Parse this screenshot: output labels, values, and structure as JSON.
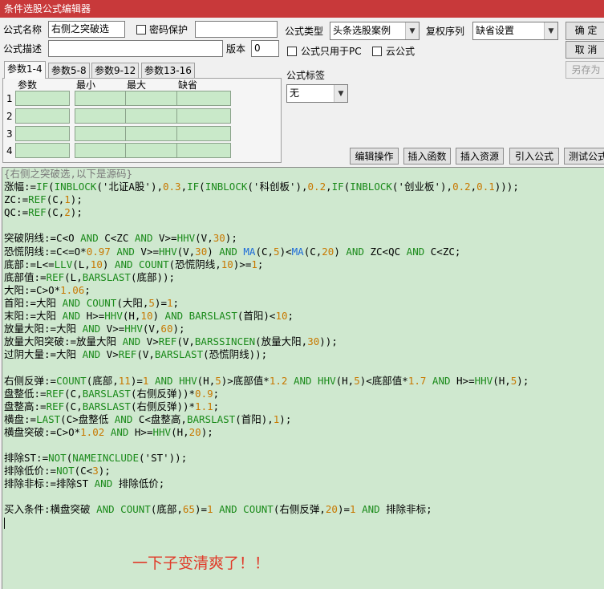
{
  "window": {
    "title": "条件选股公式编辑器"
  },
  "form": {
    "name_label": "公式名称",
    "name_value": "右侧之突破选",
    "password_label": "密码保护",
    "desc_label": "公式描述",
    "version_label": "版本",
    "version_value": "0",
    "type_label": "公式类型",
    "type_value": "头条选股案例",
    "restore_label": "复权序列",
    "restore_value": "缺省设置",
    "pc_only_label": "公式只用于PC",
    "cloud_label": "云公式",
    "tag_label": "公式标签",
    "tag_value": "无"
  },
  "buttons": {
    "ok": "确 定",
    "cancel": "取 消",
    "save_as": "另存为",
    "edit_ops": "编辑操作",
    "insert_func": "插入函数",
    "insert_res": "插入资源",
    "import": "引入公式",
    "test": "测试公式"
  },
  "tabs": [
    "参数1-4",
    "参数5-8",
    "参数9-12",
    "参数13-16"
  ],
  "params": {
    "headers": [
      "参数",
      "最小",
      "最大",
      "缺省"
    ],
    "rows": [
      "1",
      "2",
      "3",
      "4"
    ]
  },
  "code_lines": [
    [
      [
        "{右侧之突破选,以下是源码}",
        "cmt"
      ]
    ],
    [
      [
        "涨幅:=",
        ""
      ],
      [
        "IF",
        "kw"
      ],
      [
        "(",
        ""
      ],
      [
        "INBLOCK",
        "kw"
      ],
      [
        "('北证A股'),",
        ""
      ],
      [
        "0.3",
        "num"
      ],
      [
        ",",
        ""
      ],
      [
        "IF",
        "kw"
      ],
      [
        "(",
        ""
      ],
      [
        "INBLOCK",
        "kw"
      ],
      [
        "('科创板'),",
        ""
      ],
      [
        "0.2",
        "num"
      ],
      [
        ",",
        ""
      ],
      [
        "IF",
        "kw"
      ],
      [
        "(",
        ""
      ],
      [
        "INBLOCK",
        "kw"
      ],
      [
        "('创业板'),",
        ""
      ],
      [
        "0.2",
        "num"
      ],
      [
        ",",
        ""
      ],
      [
        "0.1",
        "num"
      ],
      [
        ")));",
        ""
      ]
    ],
    [
      [
        "ZC:=",
        ""
      ],
      [
        "REF",
        "kw"
      ],
      [
        "(C,",
        ""
      ],
      [
        "1",
        "num"
      ],
      [
        ");",
        ""
      ]
    ],
    [
      [
        "QC:=",
        ""
      ],
      [
        "REF",
        "kw"
      ],
      [
        "(C,",
        ""
      ],
      [
        "2",
        "num"
      ],
      [
        ");",
        ""
      ]
    ],
    [],
    [
      [
        "突破阴线:=C<O ",
        ""
      ],
      [
        "AND",
        "kw"
      ],
      [
        " C<ZC ",
        ""
      ],
      [
        "AND",
        "kw"
      ],
      [
        " V>=",
        ""
      ],
      [
        "HHV",
        "kw"
      ],
      [
        "(V,",
        ""
      ],
      [
        "30",
        "num"
      ],
      [
        ");",
        ""
      ]
    ],
    [
      [
        "恐慌阴线:=C<=O*",
        ""
      ],
      [
        "0.97",
        "num"
      ],
      [
        " ",
        ""
      ],
      [
        "AND",
        "kw"
      ],
      [
        " V>=",
        ""
      ],
      [
        "HHV",
        "kw"
      ],
      [
        "(V,",
        ""
      ],
      [
        "30",
        "num"
      ],
      [
        ") ",
        ""
      ],
      [
        "AND",
        "kw"
      ],
      [
        " ",
        ""
      ],
      [
        "MA",
        "fn2"
      ],
      [
        "(C,",
        ""
      ],
      [
        "5",
        "num"
      ],
      [
        ")<",
        ""
      ],
      [
        "MA",
        "fn2"
      ],
      [
        "(C,",
        ""
      ],
      [
        "20",
        "num"
      ],
      [
        ") ",
        ""
      ],
      [
        "AND",
        "kw"
      ],
      [
        " ZC<QC ",
        ""
      ],
      [
        "AND",
        "kw"
      ],
      [
        " C<ZC;",
        ""
      ]
    ],
    [
      [
        "底部:=L<=",
        ""
      ],
      [
        "LLV",
        "kw"
      ],
      [
        "(L,",
        ""
      ],
      [
        "10",
        "num"
      ],
      [
        ") ",
        ""
      ],
      [
        "AND",
        "kw"
      ],
      [
        " ",
        ""
      ],
      [
        "COUNT",
        "kw"
      ],
      [
        "(恐慌阴线,",
        ""
      ],
      [
        "10",
        "num"
      ],
      [
        ")>=",
        ""
      ],
      [
        "1",
        "num"
      ],
      [
        ";",
        ""
      ]
    ],
    [
      [
        "底部值:=",
        ""
      ],
      [
        "REF",
        "kw"
      ],
      [
        "(L,",
        ""
      ],
      [
        "BARSLAST",
        "kw"
      ],
      [
        "(底部));",
        ""
      ]
    ],
    [
      [
        "大阳:=C>O*",
        ""
      ],
      [
        "1.06",
        "num"
      ],
      [
        ";",
        ""
      ]
    ],
    [
      [
        "首阳:=大阳 ",
        ""
      ],
      [
        "AND",
        "kw"
      ],
      [
        " ",
        ""
      ],
      [
        "COUNT",
        "kw"
      ],
      [
        "(大阳,",
        ""
      ],
      [
        "5",
        "num"
      ],
      [
        ")=",
        ""
      ],
      [
        "1",
        "num"
      ],
      [
        ";",
        ""
      ]
    ],
    [
      [
        "末阳:=大阳 ",
        ""
      ],
      [
        "AND",
        "kw"
      ],
      [
        " H>=",
        ""
      ],
      [
        "HHV",
        "kw"
      ],
      [
        "(H,",
        ""
      ],
      [
        "10",
        "num"
      ],
      [
        ") ",
        ""
      ],
      [
        "AND",
        "kw"
      ],
      [
        " ",
        ""
      ],
      [
        "BARSLAST",
        "kw"
      ],
      [
        "(首阳)<",
        ""
      ],
      [
        "10",
        "num"
      ],
      [
        ";",
        ""
      ]
    ],
    [
      [
        "放量大阳:=大阳 ",
        ""
      ],
      [
        "AND",
        "kw"
      ],
      [
        " V>=",
        ""
      ],
      [
        "HHV",
        "kw"
      ],
      [
        "(V,",
        ""
      ],
      [
        "60",
        "num"
      ],
      [
        ");",
        ""
      ]
    ],
    [
      [
        "放量大阳突破:=放量大阳 ",
        ""
      ],
      [
        "AND",
        "kw"
      ],
      [
        " V>",
        ""
      ],
      [
        "REF",
        "kw"
      ],
      [
        "(V,",
        ""
      ],
      [
        "BARSSINCEN",
        "kw"
      ],
      [
        "(放量大阳,",
        ""
      ],
      [
        "30",
        "num"
      ],
      [
        "));",
        ""
      ]
    ],
    [
      [
        "过阴大量:=大阳 ",
        ""
      ],
      [
        "AND",
        "kw"
      ],
      [
        " V>",
        ""
      ],
      [
        "REF",
        "kw"
      ],
      [
        "(V,",
        ""
      ],
      [
        "BARSLAST",
        "kw"
      ],
      [
        "(恐慌阴线));",
        ""
      ]
    ],
    [],
    [
      [
        "右侧反弹:=",
        ""
      ],
      [
        "COUNT",
        "kw"
      ],
      [
        "(底部,",
        ""
      ],
      [
        "11",
        "num"
      ],
      [
        ")=",
        ""
      ],
      [
        "1",
        "num"
      ],
      [
        " ",
        ""
      ],
      [
        "AND",
        "kw"
      ],
      [
        " ",
        ""
      ],
      [
        "HHV",
        "kw"
      ],
      [
        "(H,",
        ""
      ],
      [
        "5",
        "num"
      ],
      [
        ")>底部值*",
        ""
      ],
      [
        "1.2",
        "num"
      ],
      [
        " ",
        ""
      ],
      [
        "AND",
        "kw"
      ],
      [
        " ",
        ""
      ],
      [
        "HHV",
        "kw"
      ],
      [
        "(H,",
        ""
      ],
      [
        "5",
        "num"
      ],
      [
        ")<底部值*",
        ""
      ],
      [
        "1.7",
        "num"
      ],
      [
        " ",
        ""
      ],
      [
        "AND",
        "kw"
      ],
      [
        " H>=",
        ""
      ],
      [
        "HHV",
        "kw"
      ],
      [
        "(H,",
        ""
      ],
      [
        "5",
        "num"
      ],
      [
        ");",
        ""
      ]
    ],
    [
      [
        "盘整低:=",
        ""
      ],
      [
        "REF",
        "kw"
      ],
      [
        "(C,",
        ""
      ],
      [
        "BARSLAST",
        "kw"
      ],
      [
        "(右侧反弹))*",
        ""
      ],
      [
        "0.9",
        "num"
      ],
      [
        ";",
        ""
      ]
    ],
    [
      [
        "盘整高:=",
        ""
      ],
      [
        "REF",
        "kw"
      ],
      [
        "(C,",
        ""
      ],
      [
        "BARSLAST",
        "kw"
      ],
      [
        "(右侧反弹))*",
        ""
      ],
      [
        "1.1",
        "num"
      ],
      [
        ";",
        ""
      ]
    ],
    [
      [
        "横盘:=",
        ""
      ],
      [
        "LAST",
        "kw"
      ],
      [
        "(C>盘整低 ",
        ""
      ],
      [
        "AND",
        "kw"
      ],
      [
        " C<盘整高,",
        ""
      ],
      [
        "BARSLAST",
        "kw"
      ],
      [
        "(首阳),",
        ""
      ],
      [
        "1",
        "num"
      ],
      [
        ");",
        ""
      ]
    ],
    [
      [
        "横盘突破:=C>O*",
        ""
      ],
      [
        "1.02",
        "num"
      ],
      [
        " ",
        ""
      ],
      [
        "AND",
        "kw"
      ],
      [
        " H>=",
        ""
      ],
      [
        "HHV",
        "kw"
      ],
      [
        "(H,",
        ""
      ],
      [
        "20",
        "num"
      ],
      [
        ");",
        ""
      ]
    ],
    [],
    [
      [
        "排除ST:=",
        ""
      ],
      [
        "NOT",
        "kw"
      ],
      [
        "(",
        ""
      ],
      [
        "NAMEINCLUDE",
        "kw"
      ],
      [
        "('ST'));",
        ""
      ]
    ],
    [
      [
        "排除低价:=",
        ""
      ],
      [
        "NOT",
        "kw"
      ],
      [
        "(C<",
        ""
      ],
      [
        "3",
        "num"
      ],
      [
        ");",
        ""
      ]
    ],
    [
      [
        "排除非标:=排除ST ",
        ""
      ],
      [
        "AND",
        "kw"
      ],
      [
        " 排除低价;",
        ""
      ]
    ],
    [],
    [
      [
        "买入条件:横盘突破 ",
        ""
      ],
      [
        "AND",
        "kw"
      ],
      [
        " ",
        ""
      ],
      [
        "COUNT",
        "kw"
      ],
      [
        "(底部,",
        ""
      ],
      [
        "65",
        "num"
      ],
      [
        ")=",
        ""
      ],
      [
        "1",
        "num"
      ],
      [
        " ",
        ""
      ],
      [
        "AND",
        "kw"
      ],
      [
        " ",
        ""
      ],
      [
        "COUNT",
        "kw"
      ],
      [
        "(右侧反弹,",
        ""
      ],
      [
        "20",
        "num"
      ],
      [
        ")=",
        ""
      ],
      [
        "1",
        "num"
      ],
      [
        " ",
        ""
      ],
      [
        "AND",
        "kw"
      ],
      [
        " 排除非标;",
        ""
      ]
    ]
  ],
  "annotation": "一下子变清爽了！！",
  "colors": {
    "titlebar": "#c8393a",
    "editor_bg": "#cfe8cf",
    "keyword": "#1a8a1a",
    "number": "#c87800",
    "ma": "#1c6bd8",
    "note": "#e03b2a"
  }
}
